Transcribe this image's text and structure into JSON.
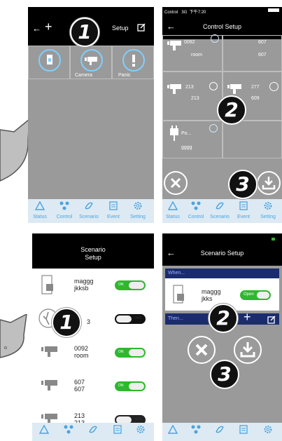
{
  "phone1": {
    "title": "Setup",
    "back_icon": "arrow-left-icon",
    "add_icon": "plus-icon",
    "edit_icon": "edit-icon",
    "devices": [
      {
        "label": "",
        "icon": "door-lock-icon"
      },
      {
        "label": "Camera",
        "icon": "camera-icon"
      },
      {
        "label": "Panic",
        "icon": "exclamation-icon"
      }
    ]
  },
  "phone2": {
    "status_bar": {
      "carrier": "Control",
      "network": "3G",
      "time": "下午7:20"
    },
    "title": "Control Setup",
    "devices": [
      {
        "line1": "0092",
        "line2": "room",
        "icon": "camera-icon"
      },
      {
        "line1": "607",
        "line2": "607",
        "icon": "camera-icon"
      },
      {
        "line1": "213",
        "line2": "213",
        "icon": "camera-icon"
      },
      {
        "line1": "277",
        "line2": "609",
        "icon": "camera-icon"
      },
      {
        "line1": "Po...",
        "line2": "gggg",
        "icon": "plug-icon"
      }
    ]
  },
  "phone3": {
    "title_line1": "Scenario",
    "title_line2": "Setup",
    "rows": [
      {
        "line1": "maggg",
        "line2": "jkksb",
        "state": "ON",
        "icon": "door-icon"
      },
      {
        "line1": "",
        "line2": "3",
        "state": "OFF",
        "icon": "motion-sensor-icon"
      },
      {
        "line1": "0092",
        "line2": "room",
        "state": "ON",
        "icon": "camera-icon"
      },
      {
        "line1": "607",
        "line2": "607",
        "state": "ON",
        "icon": "camera-icon"
      },
      {
        "line1": "213",
        "line2": "213",
        "state": "OFF",
        "icon": "camera-icon"
      }
    ]
  },
  "phone4": {
    "title": "Scenario Setup",
    "when_label": "When...",
    "then_label": "Then...",
    "device_line1": "maggg",
    "device_line2": "jkks",
    "device_state": "Open"
  },
  "tabs": [
    "Status",
    "Control",
    "Scenario",
    "Event",
    "Setting"
  ],
  "callouts": {
    "one": "1",
    "two": "2",
    "three": "3"
  },
  "colors": {
    "accent": "#4aa3df",
    "toggle_on": "#2eb82e",
    "header": "#000000",
    "grid": "#9a9a9a"
  }
}
